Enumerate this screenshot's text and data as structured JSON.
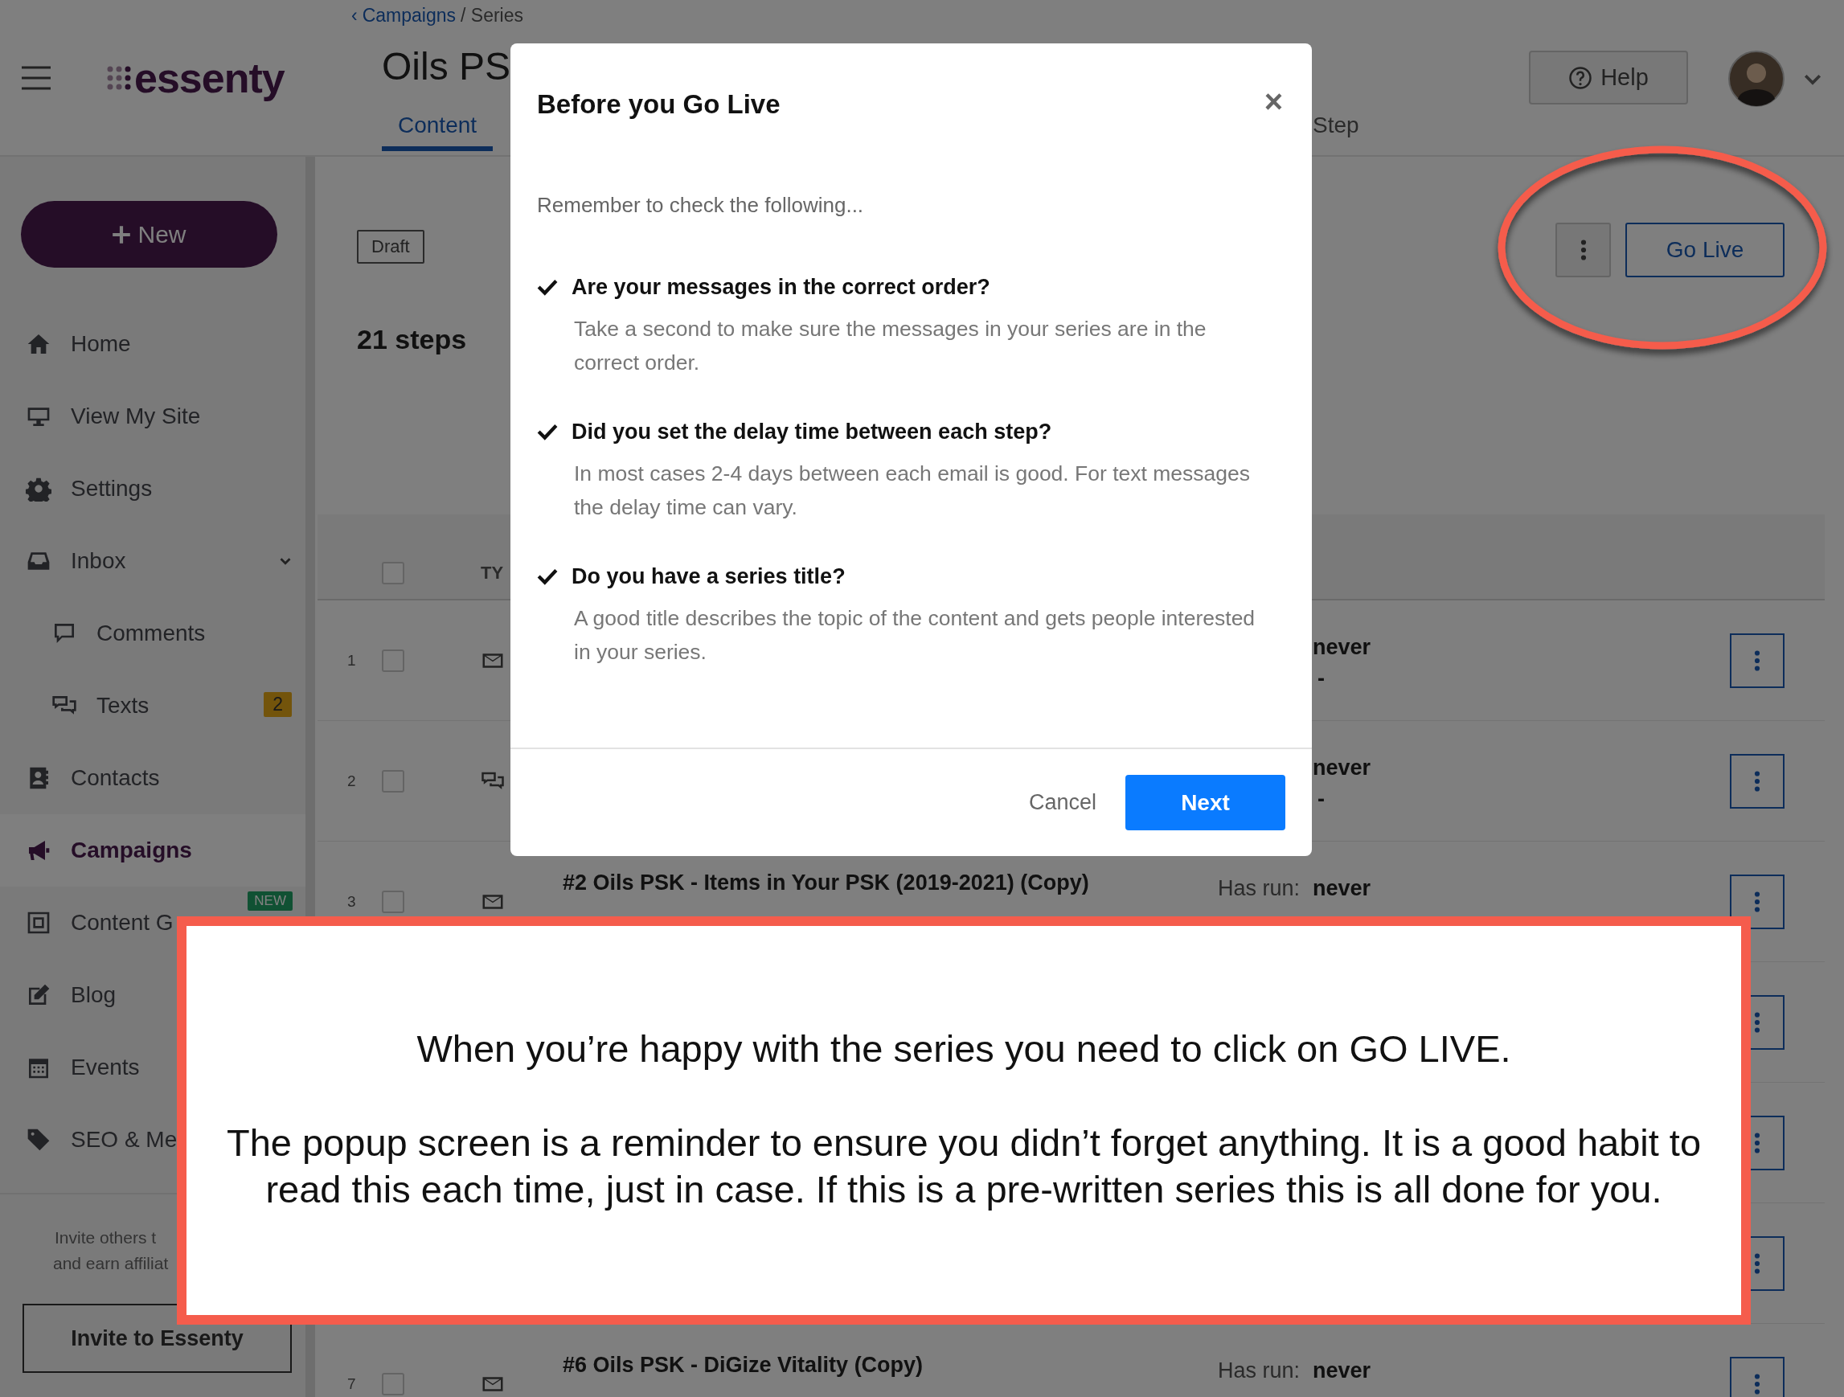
{
  "header": {
    "breadcrumb": {
      "back": "‹",
      "link": "Campaigns",
      "current": "/ Series"
    },
    "title": "Oils PS",
    "tabs": [
      {
        "label": "Content",
        "selected": true
      },
      {
        "label": "Step",
        "selected": false
      }
    ],
    "help": "Help"
  },
  "logo": "essenty",
  "sidebar": {
    "new_button": "New",
    "items": [
      {
        "label": "Home",
        "selected": false
      },
      {
        "label": "View My Site",
        "selected": false
      },
      {
        "label": "Settings",
        "selected": false
      },
      {
        "label": "Inbox",
        "selected": false,
        "expanded": true,
        "children": [
          {
            "label": "Comments",
            "selected": false
          },
          {
            "label": "Texts",
            "selected": false,
            "badge": {
              "text": "2",
              "kind": "count"
            }
          }
        ]
      },
      {
        "label": "Contacts",
        "selected": false
      },
      {
        "label": "Campaigns",
        "selected": true
      },
      {
        "label": "Content G",
        "selected": false,
        "badge": {
          "text": "NEW",
          "kind": "new"
        }
      },
      {
        "label": "Blog",
        "selected": false
      },
      {
        "label": "Events",
        "selected": false
      },
      {
        "label": "SEO & Me",
        "selected": false
      }
    ],
    "invite_text": [
      "Invite others t",
      "and earn affiliat"
    ],
    "invite_button": "Invite to Essenty"
  },
  "main": {
    "status": "Draft",
    "steps": "21 steps",
    "go_live": "Go Live",
    "table": {
      "select_all": {
        "checked": false
      },
      "columns": [
        "TY"
      ],
      "rows": [
        {
          "number": "1",
          "checked": false,
          "kind": "email",
          "run_value": "never",
          "next": "-"
        },
        {
          "number": "2",
          "checked": false,
          "kind": "text",
          "run_value": "never",
          "next": "-"
        },
        {
          "number": "3",
          "checked": false,
          "kind": "email",
          "title": "#2 Oils PSK - Items in Your PSK (2019-2021) (Copy)",
          "run_label": "Has run:",
          "run_value": "never"
        },
        {},
        {},
        {},
        {
          "number": "7",
          "checked": false,
          "kind": "email",
          "title": "#6 Oils PSK - DiGize Vitality (Copy)",
          "run_label": "Has run:",
          "run_value": "never"
        }
      ]
    }
  },
  "modal": {
    "title": "Before you Go Live",
    "close": "×",
    "intro": "Remember to check the following...",
    "items": [
      {
        "checked": true,
        "title": "Are your messages in the correct order?",
        "text": "Take a second to make sure the messages in your series are in the correct order."
      },
      {
        "checked": true,
        "title": "Did you set the delay time between each step?",
        "text": "In most cases 2-4 days between each email is good. For text messages the delay time can vary."
      },
      {
        "checked": true,
        "title": "Do you have a series title?",
        "text": "A good title describes the topic of the content and gets people interested in your series."
      }
    ],
    "cancel": "Cancel",
    "next": "Next"
  },
  "annotation": {
    "heading": "When you’re happy with the series you need to click on GO LIVE.",
    "text": "The popup screen is a reminder to ensure you didn’t forget anything. It is a good habit to read this each time, just in case. If this is a pre-written series this is all done for you."
  }
}
